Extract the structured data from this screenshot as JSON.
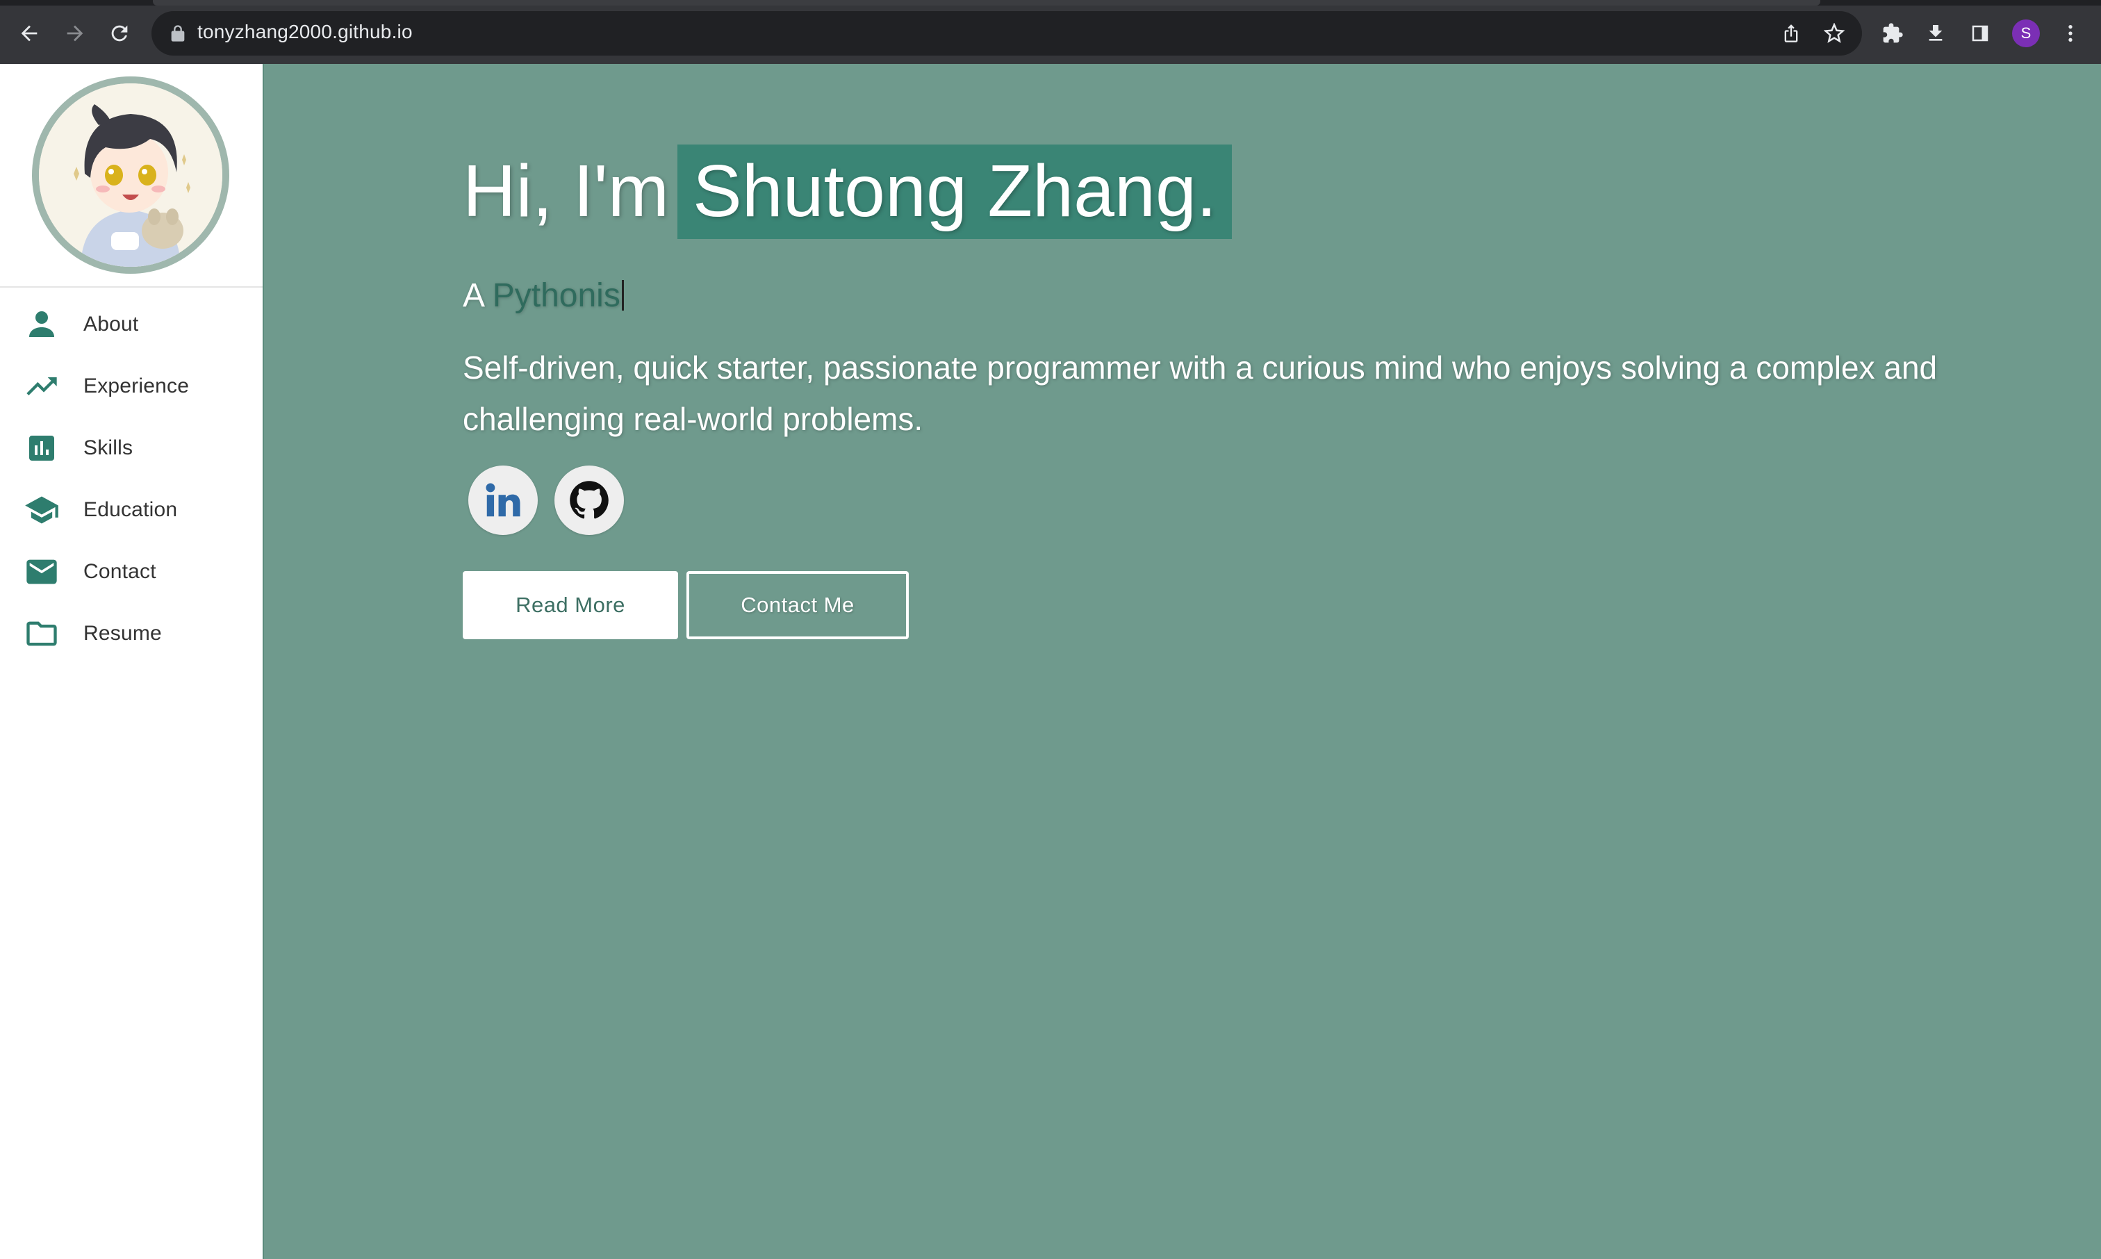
{
  "browser": {
    "url": "tonyzhang2000.github.io",
    "profile_initial": "S",
    "icons": {
      "back": "arrow-left-icon",
      "forward": "arrow-right-icon",
      "reload": "reload-icon",
      "lock": "lock-icon",
      "share": "share-icon",
      "bookmark": "star-icon",
      "extensions": "puzzle-icon",
      "downloads": "download-icon",
      "sidepanel": "side-panel-icon",
      "menu": "kebab-menu-icon"
    }
  },
  "sidebar": {
    "avatar_alt": "profile avatar",
    "items": [
      {
        "label": "About",
        "icon": "person-icon"
      },
      {
        "label": "Experience",
        "icon": "trending-up-icon"
      },
      {
        "label": "Skills",
        "icon": "bar-chart-icon"
      },
      {
        "label": "Education",
        "icon": "graduation-cap-icon"
      },
      {
        "label": "Contact",
        "icon": "mail-icon"
      },
      {
        "label": "Resume",
        "icon": "folder-icon"
      }
    ]
  },
  "hero": {
    "greeting_prefix": "Hi, I'm",
    "name": "Shutong Zhang.",
    "typed_prefix": "A",
    "typed_word": "Pythonis",
    "description": "Self-driven, quick starter, passionate programmer with a curious mind who enjoys solving a complex and challenging real-world problems.",
    "social": [
      {
        "name": "linkedin",
        "icon": "linkedin-icon"
      },
      {
        "name": "github",
        "icon": "github-icon"
      }
    ],
    "read_more_label": "Read More",
    "contact_label": "Contact Me"
  },
  "colors": {
    "page_bg": "#6f9a8d",
    "accent": "#3a8575",
    "sidebar_icon": "#2e7d6e",
    "chrome": "#35363a"
  }
}
